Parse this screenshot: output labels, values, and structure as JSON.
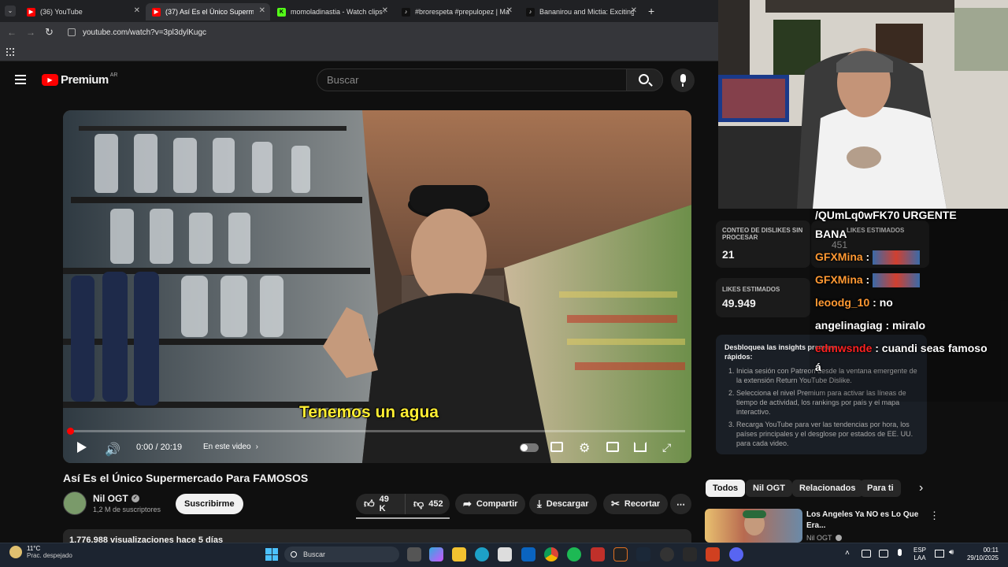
{
  "browser": {
    "tabs": [
      {
        "label": "(36) YouTube",
        "color": "#ff0000"
      },
      {
        "label": "(37) Así Es el Único Supermercado",
        "color": "#ff0000",
        "active": true
      },
      {
        "label": "momoladinastia - Watch clips o",
        "color": "#53fc18"
      },
      {
        "label": "#brorespeta #prepulopez | Mar",
        "color": "#000000"
      },
      {
        "label": "Bananirou and Mictia: Exciting",
        "color": "#000000"
      }
    ],
    "new_tab": "+",
    "url": "youtube.com/watch?v=3pl3dylKugc"
  },
  "youtube": {
    "logo_text": "Premium",
    "region": "AR",
    "search_placeholder": "Buscar"
  },
  "video": {
    "subtitle": "Tenemos un agua",
    "time": "0:00 / 20:19",
    "chapter": "En este video",
    "title": "Así Es el Único Supermercado Para FAMOSOS",
    "channel": "Nil OGT",
    "subscribers": "1,2 M de suscriptores",
    "subscribe": "Suscribirme",
    "likes": "49 K",
    "dislikes": "452",
    "share": "Compartir",
    "download": "Descargar",
    "clip": "Recortar",
    "views": "1.776.988 visualizaciones  hace 5 días",
    "progress": 0.0
  },
  "ryd": {
    "dislike_label": "CONTEO DE DISLIKES SIN PROCESAR",
    "dislike_value": "21",
    "likes_label": "LIKES ESTIMADOS",
    "likes_value": "49.949",
    "dislikes_est_label": "LIKES ESTIMADOS",
    "dislikes_est_value": "451",
    "unlock_title": "Desbloquea las insights premium",
    "unlock_title2": "rápidos:",
    "steps": [
      "Inicia sesión con Patreon desde la ventana emergente de la extensión Return YouTube Dislike.",
      "Selecciona el nivel Premium para activar las líneas de tiempo de actividad, los rankings por país y el mapa interactivo.",
      "Recarga YouTube para ver las tendencias por hora, los países principales y el desglose por estados de EE. UU. para cada video."
    ]
  },
  "chips": [
    "Todos",
    "Nil OGT",
    "Relacionados",
    "Para ti"
  ],
  "recommended": {
    "title": "Los Angeles Ya NO es Lo Que Era...",
    "channel": "Nil OGT"
  },
  "chat": [
    {
      "user": "",
      "text": "/QUmLq0wFK70 URGENTE"
    },
    {
      "user": "",
      "text": "BANA"
    },
    {
      "user": "GFXMina",
      "text": " : "
    },
    {
      "user": "GFXMina",
      "text": " : "
    },
    {
      "user": "leoodg_10",
      "text": " : no"
    },
    {
      "user": "angelinagiag",
      "text": " : miralo"
    },
    {
      "user": "edmwsnde",
      "text": " : cuandi seas famoso"
    },
    {
      "user": "",
      "text": "á"
    }
  ],
  "chat_colors": {
    "GFXMina": "#ff9933",
    "leoodg_10": "#ff9933",
    "angelinagiag": "#ffffff",
    "edmwsnde": "#ff2222"
  },
  "taskbar": {
    "weather_temp": "11°C",
    "weather_desc": "Prac. despejado",
    "search": "Buscar",
    "lang": "ESP",
    "lang2": "LAA",
    "time": "00:11",
    "date": "29/10/2025"
  }
}
